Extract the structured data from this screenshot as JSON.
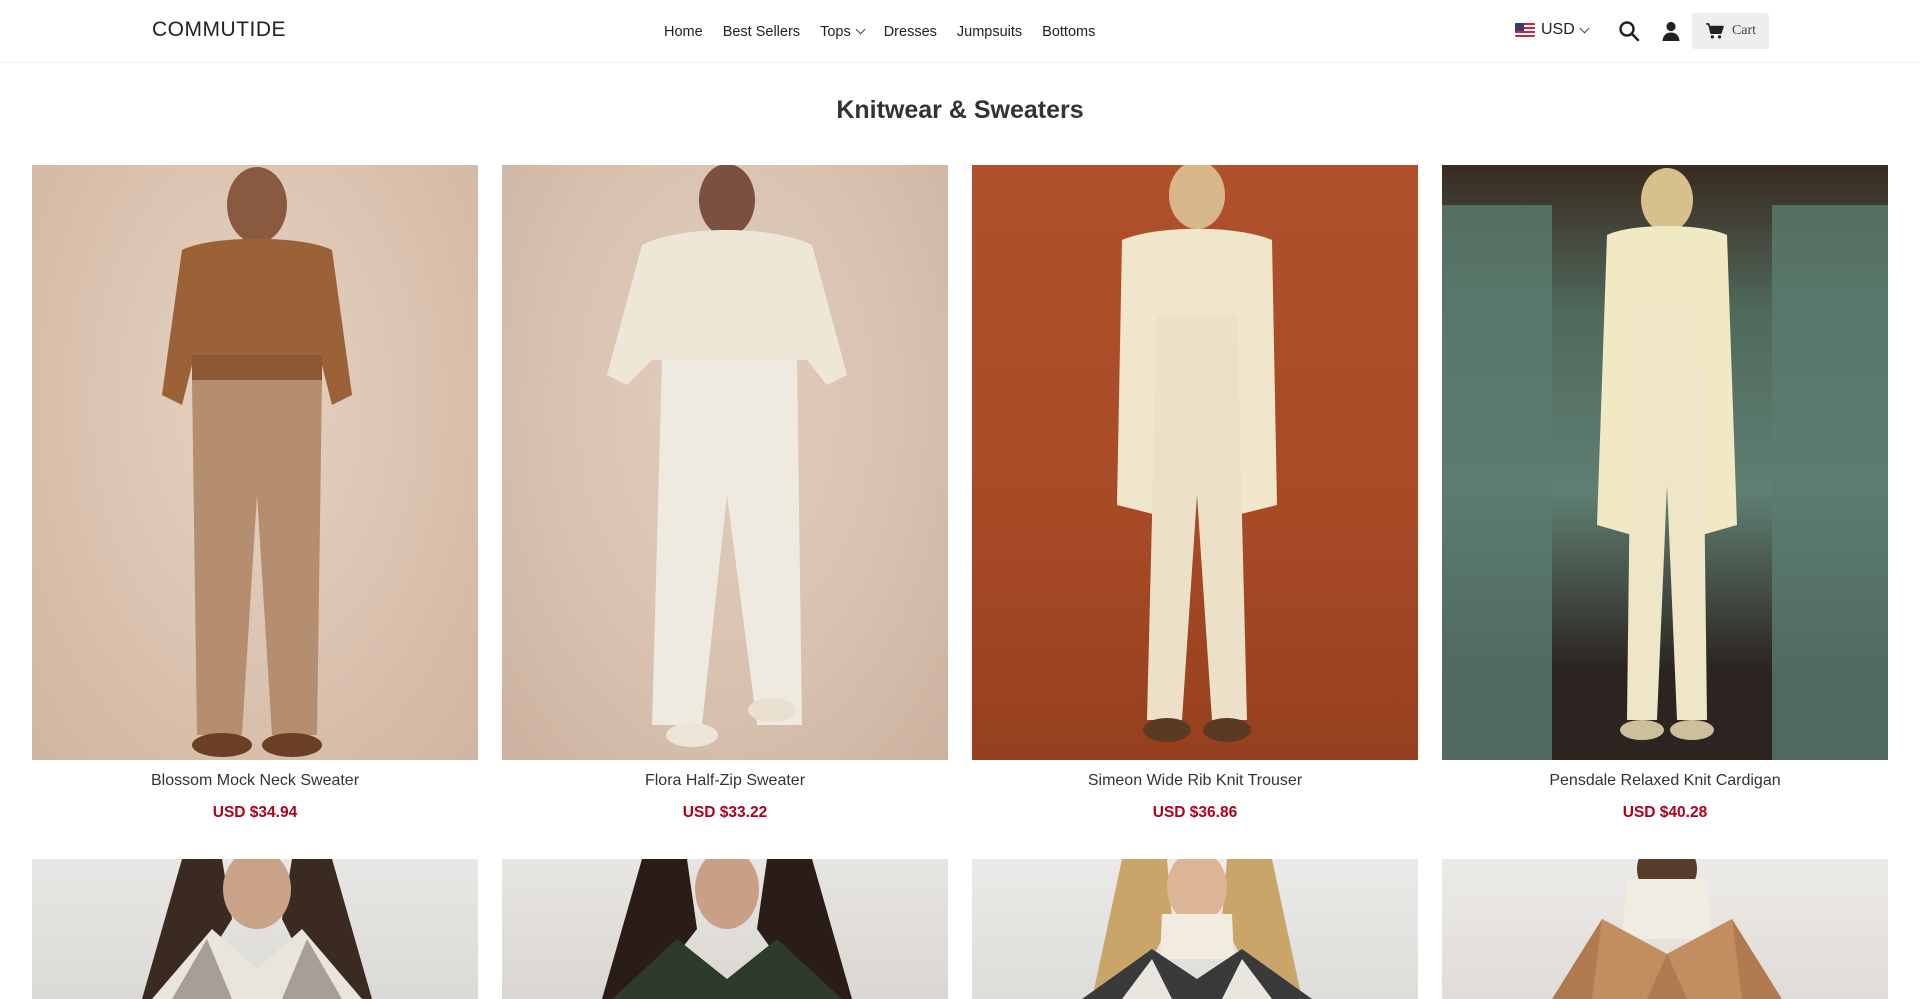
{
  "header": {
    "logo": "COMMUTIDE",
    "nav": [
      {
        "label": "Home"
      },
      {
        "label": "Best Sellers"
      },
      {
        "label": "Tops",
        "has_dropdown": true
      },
      {
        "label": "Dresses"
      },
      {
        "label": "Jumpsuits"
      },
      {
        "label": "Bottoms"
      }
    ],
    "currency": "USD",
    "cart_label": "Cart",
    "icons": {
      "search": "search-icon",
      "account": "user-icon",
      "cart": "cart-icon",
      "flag": "us-flag-icon"
    }
  },
  "collection": {
    "title": "Knitwear & Sweaters",
    "products": [
      {
        "name": "Blossom Mock Neck Sweater",
        "price": "USD $34.94"
      },
      {
        "name": "Flora Half-Zip Sweater",
        "price": "USD $33.22"
      },
      {
        "name": "Simeon Wide Rib Knit Trouser",
        "price": "USD $36.86"
      },
      {
        "name": "Pensdale Relaxed Knit Cardigan",
        "price": "USD $40.28"
      }
    ]
  },
  "colors": {
    "price": "#b0001a",
    "cart_bg": "#eeeeee"
  }
}
